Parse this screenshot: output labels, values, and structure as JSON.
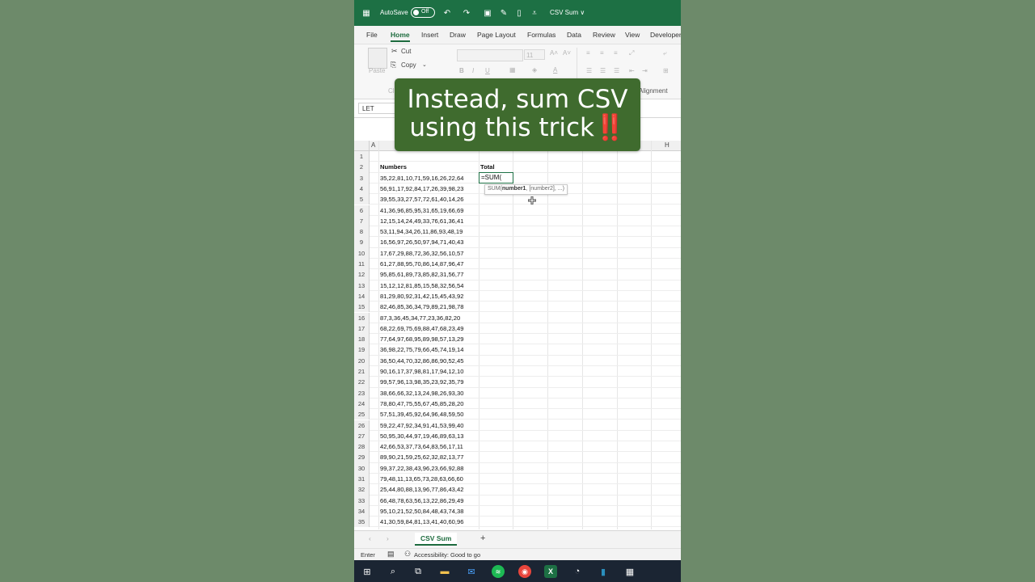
{
  "titlebar": {
    "autosave_label": "AutoSave",
    "autosave_state": "Off",
    "doc_title": "CSV Sum ∨",
    "color": "#1d7044"
  },
  "menu": {
    "tabs": [
      "File",
      "Home",
      "Insert",
      "Draw",
      "Page Layout",
      "Formulas",
      "Data",
      "Review",
      "View",
      "Developer"
    ],
    "active": "Home"
  },
  "ribbon": {
    "clipboard": {
      "paste": "Paste",
      "cut": "Cut",
      "copy": "Copy",
      "group": "Cl"
    },
    "font_size": "11",
    "alignment_group": "Alignment"
  },
  "namebox": "LET",
  "columns": {
    "left": "A",
    "right": "H"
  },
  "header_row": {
    "a": "Numbers",
    "b": "Total"
  },
  "rows": [
    "35,22,81,10,71,59,16,26,22,64",
    "56,91,17,92,84,17,26,39,98,23",
    "39,55,33,27,57,72,61,40,14,26",
    "41,36,96,85,95,31,65,19,66,69",
    "12,15,14,24,49,33,76,61,36,41",
    "53,11,94,34,26,11,86,93,48,19",
    "16,56,97,26,50,97,94,71,40,43",
    "17,67,29,88,72,36,32,56,10,57",
    "61,27,88,95,70,86,14,87,96,47",
    "95,85,61,89,73,85,82,31,56,77",
    "15,12,12,81,85,15,58,32,56,54",
    "81,29,80,92,31,42,15,45,43,92",
    "82,46,85,36,34,79,89,21,98,78",
    "87,3,36,45,34,77,23,36,82,20",
    "68,22,69,75,69,88,47,68,23,49",
    "77,64,97,68,95,89,98,57,13,29",
    "36,98,22,75,79,66,45,74,19,14",
    "36,50,44,70,32,86,86,90,52,45",
    "90,16,17,37,98,81,17,94,12,10",
    "99,57,96,13,98,35,23,92,35,79",
    "38,66,66,32,13,24,98,26,93,30",
    "78,80,47,75,55,67,45,85,28,20",
    "57,51,39,45,92,64,96,48,59,50",
    "59,22,47,92,34,91,41,53,99,40",
    "50,95,30,44,97,19,46,89,63,13",
    "42,66,53,37,73,64,83,56,17,11",
    "89,90,21,59,25,62,32,82,13,77",
    "99,37,22,38,43,96,23,66,92,88",
    "79,48,11,13,65,73,28,63,66,60",
    "25,44,80,88,13,96,77,86,43,42",
    "66,48,78,63,56,13,22,86,29,49",
    "95,10,21,52,50,84,48,43,74,38",
    "41,30,59,84,81,13,41,40,60,96"
  ],
  "editing_cell": {
    "value": "=SUM("
  },
  "tooltip": {
    "func": "SUM(",
    "arg_active": "number1",
    "rest": ", [number2], ...)"
  },
  "sheet_tab": "CSV Sum",
  "add_sheet": "+",
  "status": {
    "mode": "Enter",
    "accessibility": "Accessibility: Good to go"
  },
  "overlay": {
    "line1": "Instead, sum CSV",
    "line2": "using this trick",
    "emoji": "‼️"
  }
}
